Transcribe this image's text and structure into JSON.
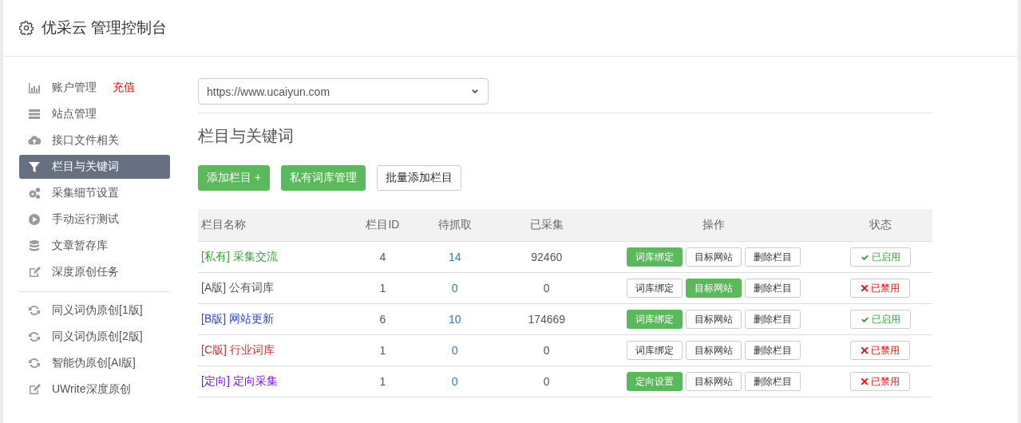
{
  "header": {
    "title": "优采云 管理控制台"
  },
  "sidebar": {
    "sections": [
      {
        "items": [
          {
            "label": "账户管理",
            "badge": "充值",
            "selected": false
          },
          {
            "label": "站点管理",
            "selected": false
          },
          {
            "label": "接口文件相关",
            "selected": false
          },
          {
            "label": "栏目与关键词",
            "selected": true
          },
          {
            "label": "采集细节设置",
            "selected": false
          },
          {
            "label": "手动运行测试",
            "selected": false
          },
          {
            "label": "文章暂存库",
            "selected": false
          },
          {
            "label": "深度原创任务",
            "selected": false
          }
        ]
      },
      {
        "items": [
          {
            "label": "同义词伪原创[1版]",
            "selected": false
          },
          {
            "label": "同义词伪原创[2版]",
            "selected": false
          },
          {
            "label": "智能伪原创[AI版]",
            "selected": false
          },
          {
            "label": "UWrite深度原创",
            "selected": false
          }
        ]
      }
    ]
  },
  "site_select": {
    "value": "https://www.ucaiyun.com"
  },
  "heading": "栏目与关键词",
  "toolbar": [
    {
      "label": "添加栏目 +",
      "primary": true
    },
    {
      "label": "私有词库管理",
      "primary": true
    },
    {
      "label": "批量添加栏目",
      "primary": false
    }
  ],
  "table": {
    "columns": [
      "栏目名称",
      "栏目ID",
      "待抓取",
      "已采集",
      "操作",
      "状态"
    ],
    "rows": [
      {
        "tag": "[私有]",
        "name": "采集交流",
        "color": "#3c9a3c",
        "id": "4",
        "pending": "14",
        "collected": "92460",
        "actions": [
          {
            "label": "词库绑定",
            "primary": true
          },
          {
            "label": "目标网站",
            "primary": false
          },
          {
            "label": "删除栏目",
            "primary": false
          }
        ],
        "status": {
          "label": "已启用",
          "enabled": true
        }
      },
      {
        "tag": "[A版]",
        "name": "公有词库",
        "color": "#555555",
        "id": "1",
        "pending": "0",
        "collected": "0",
        "actions": [
          {
            "label": "词库绑定",
            "primary": false
          },
          {
            "label": "目标网站",
            "primary": true
          },
          {
            "label": "删除栏目",
            "primary": false
          }
        ],
        "status": {
          "label": "已禁用",
          "enabled": false
        }
      },
      {
        "tag": "[B版]",
        "name": "网站更新",
        "color": "#3344cc",
        "id": "6",
        "pending": "10",
        "collected": "174669",
        "actions": [
          {
            "label": "词库绑定",
            "primary": true
          },
          {
            "label": "目标网站",
            "primary": false
          },
          {
            "label": "删除栏目",
            "primary": false
          }
        ],
        "status": {
          "label": "已启用",
          "enabled": true
        }
      },
      {
        "tag": "[C版]",
        "name": "行业词库",
        "color": "#cc3333",
        "id": "1",
        "pending": "0",
        "collected": "0",
        "actions": [
          {
            "label": "词库绑定",
            "primary": false
          },
          {
            "label": "目标网站",
            "primary": false
          },
          {
            "label": "删除栏目",
            "primary": false
          }
        ],
        "status": {
          "label": "已禁用",
          "enabled": false
        }
      },
      {
        "tag": "[定向]",
        "name": "定向采集",
        "color": "#7a11dd",
        "id": "1",
        "pending": "0",
        "collected": "0",
        "actions": [
          {
            "label": "定向设置",
            "primary": true
          },
          {
            "label": "目标网站",
            "primary": false
          },
          {
            "label": "删除栏目",
            "primary": false
          }
        ],
        "status": {
          "label": "已禁用",
          "enabled": false
        }
      }
    ]
  }
}
